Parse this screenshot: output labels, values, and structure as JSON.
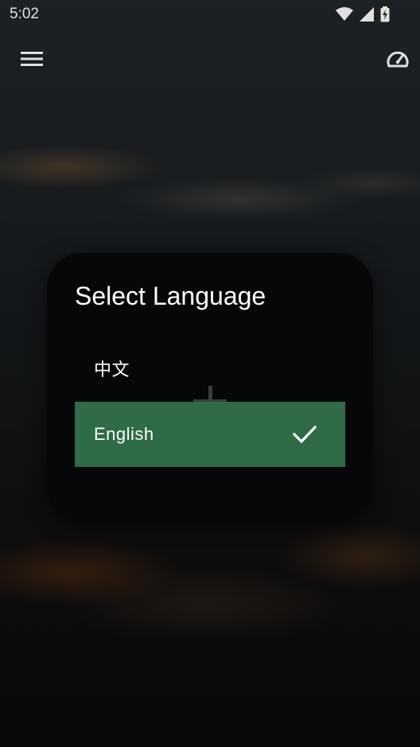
{
  "status_bar": {
    "time": "5:02",
    "icons": [
      "wifi-icon",
      "cellular-signal-icon",
      "battery-charging-icon"
    ]
  },
  "toolbar": {
    "menu_icon": "menu-icon",
    "speed_icon": "speedometer-icon"
  },
  "dialog": {
    "title": "Select Language",
    "options": [
      {
        "label": "中文",
        "selected": false
      },
      {
        "label": "English",
        "selected": true
      }
    ],
    "check_icon": "checkmark-icon"
  },
  "colors": {
    "selected_background": "#2e6b46",
    "dialog_background": "#060708",
    "text": "#ffffff"
  }
}
